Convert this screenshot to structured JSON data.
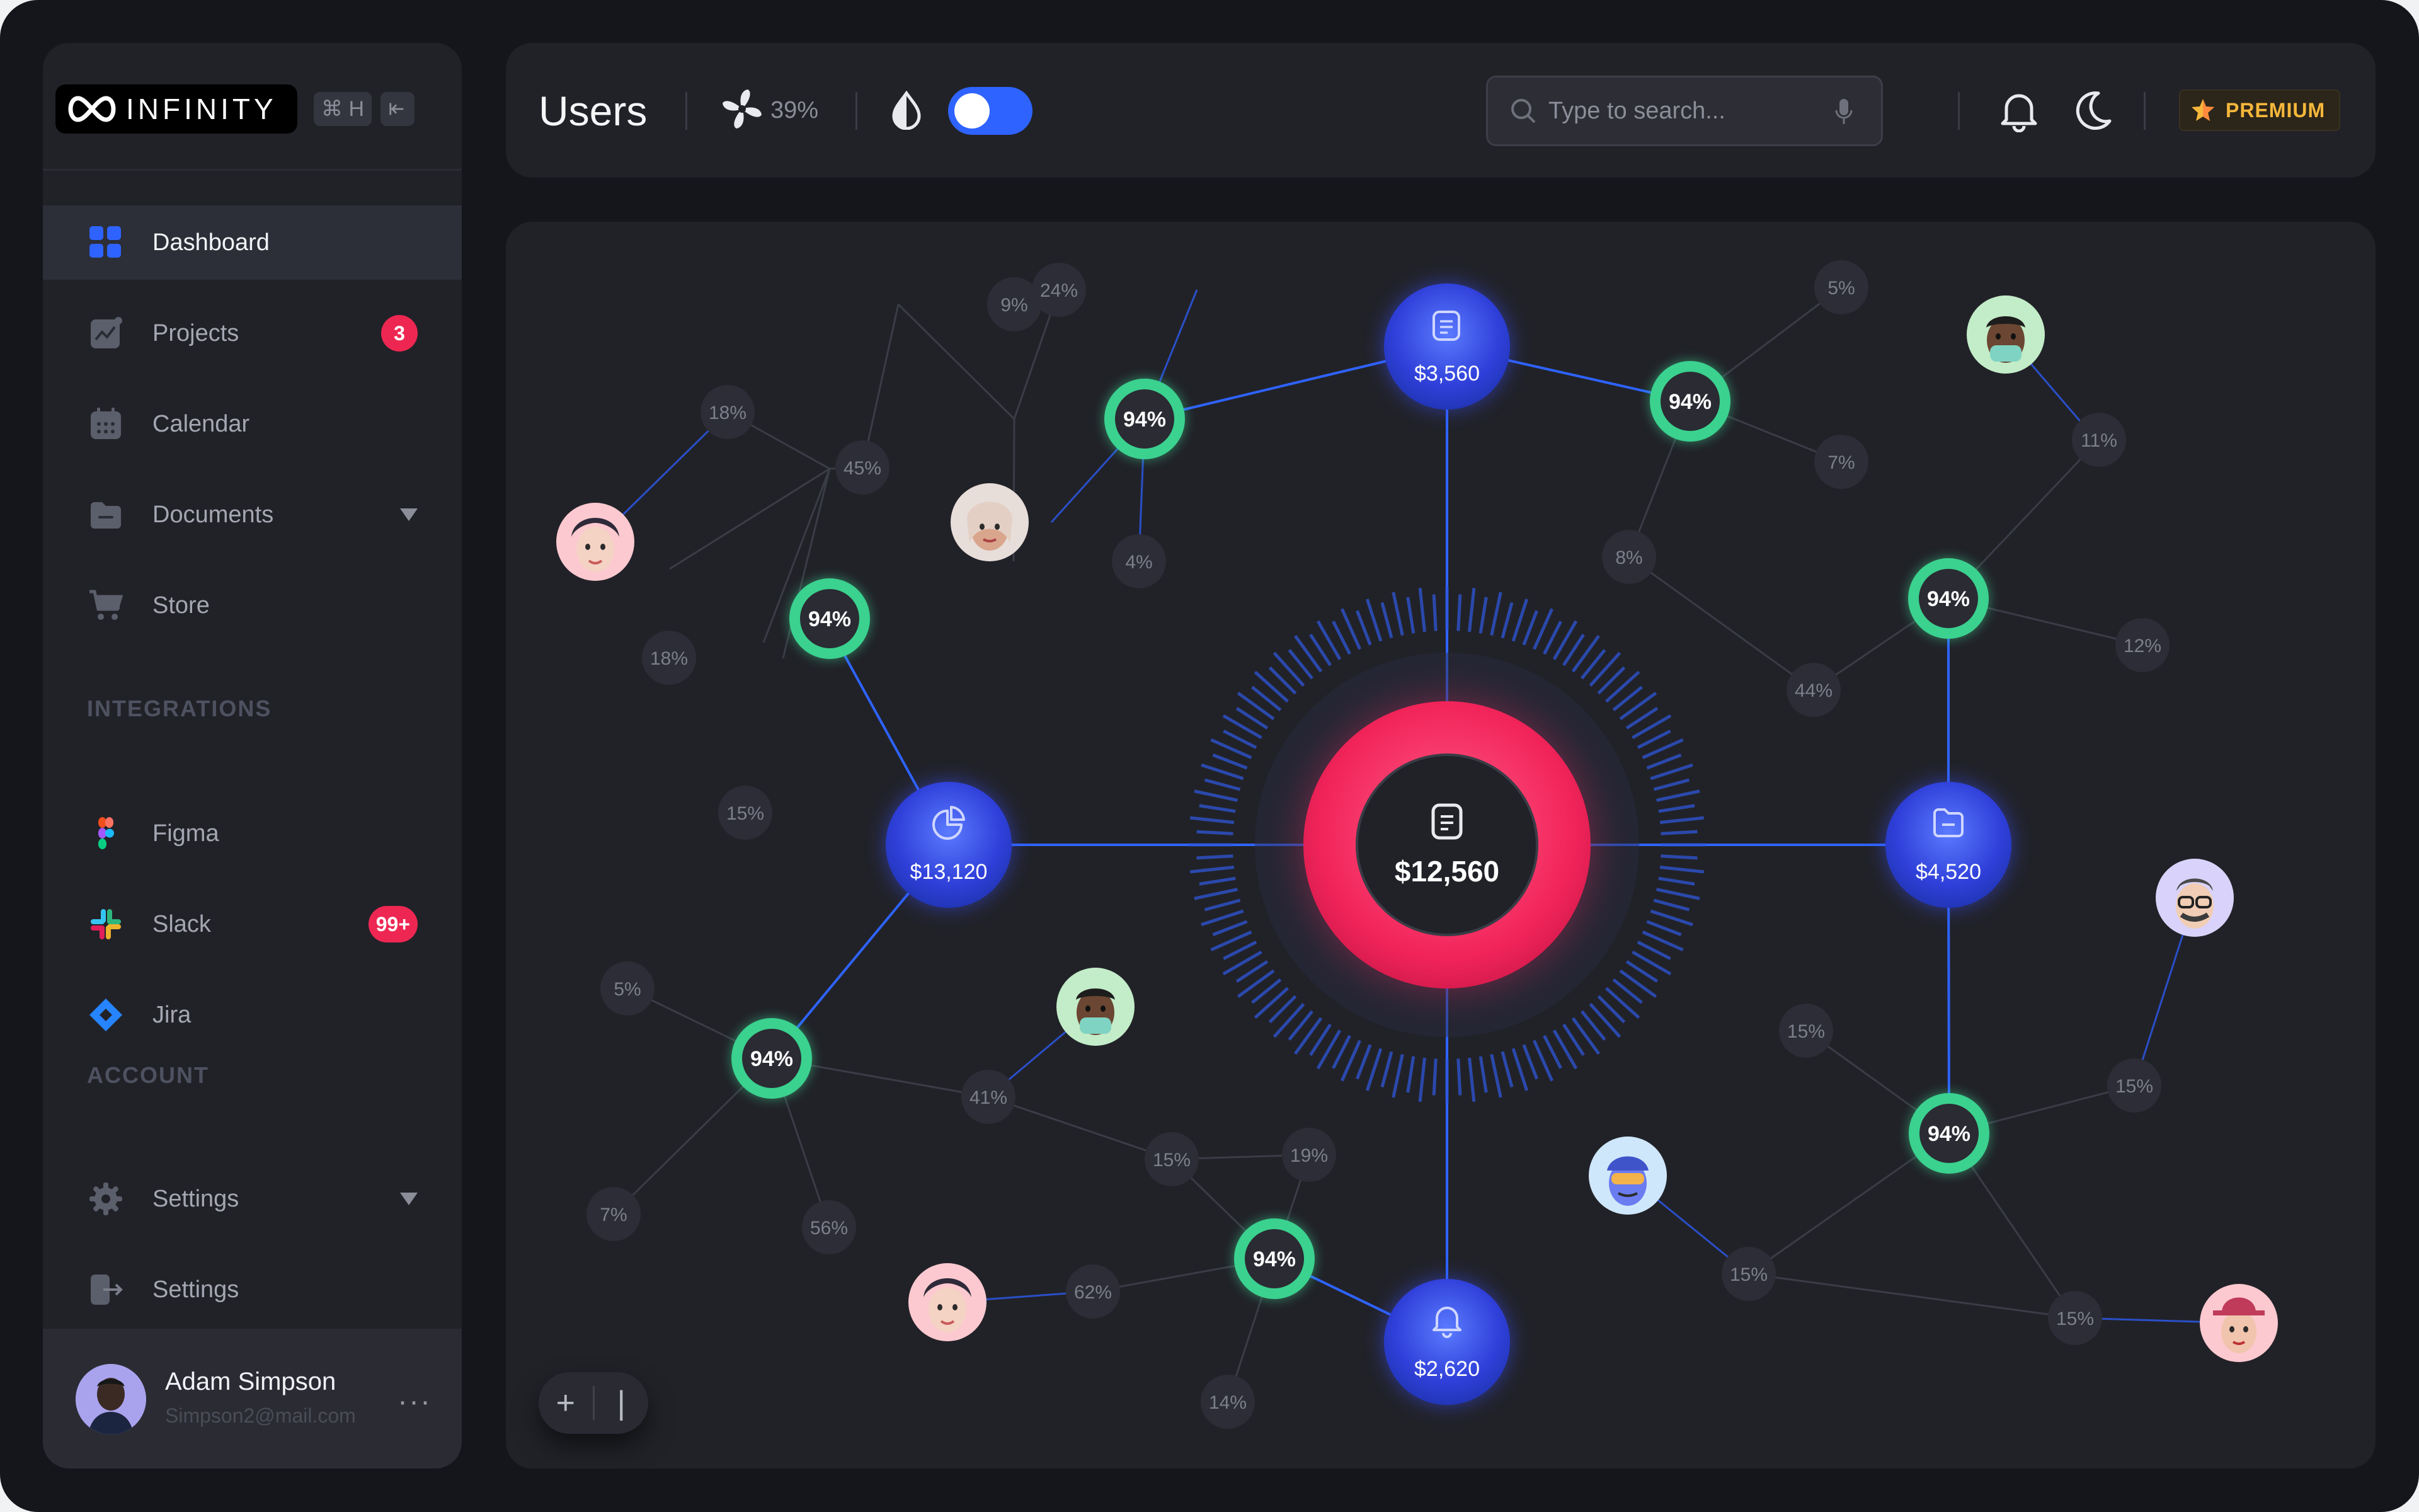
{
  "app": {
    "logo_text": "INFINITY",
    "shortcut_key": "⌘ H",
    "collapse_icon": "arrow-left-icon"
  },
  "sidebar": {
    "items": [
      {
        "label": "Dashboard",
        "icon": "grid-icon",
        "active": true
      },
      {
        "label": "Projects",
        "icon": "chart-icon",
        "badge": "3"
      },
      {
        "label": "Calendar",
        "icon": "calendar-icon"
      },
      {
        "label": "Documents",
        "icon": "folder-icon",
        "has_dropdown": true
      },
      {
        "label": "Store",
        "icon": "cart-icon"
      }
    ],
    "integrations_title": "INTEGRATIONS",
    "integrations": [
      {
        "label": "Figma",
        "icon": "figma-icon"
      },
      {
        "label": "Slack",
        "icon": "slack-icon",
        "badge": "99+"
      },
      {
        "label": "Jira",
        "icon": "jira-icon"
      }
    ],
    "account_title": "ACCOUNT",
    "account": [
      {
        "label": "Settings",
        "icon": "gear-icon",
        "has_dropdown": true
      },
      {
        "label": "Settings",
        "icon": "logout-icon"
      }
    ],
    "user": {
      "name": "Adam Simpson",
      "email": "Simpson2@mail.com"
    }
  },
  "header": {
    "title": "Users",
    "fan_percent": "39%",
    "toggle_on": true,
    "search_placeholder": "Type to search...",
    "premium_label": "PREMIUM"
  },
  "graph": {
    "center_value": "$12,560",
    "hubs": [
      {
        "id": "hub-top",
        "value": "$3,560",
        "icon": "document-icon"
      },
      {
        "id": "hub-left",
        "value": "$13,120",
        "icon": "pie-icon"
      },
      {
        "id": "hub-right",
        "value": "$4,520",
        "icon": "folder-icon"
      },
      {
        "id": "hub-bottom",
        "value": "$2,620",
        "icon": "bell-icon"
      }
    ],
    "green_nodes": [
      "94%",
      "94%",
      "94%",
      "94%",
      "94%",
      "94%",
      "94%"
    ],
    "percent_labels": [
      "9%",
      "24%",
      "18%",
      "45%",
      "4%",
      "18%",
      "15%",
      "5%",
      "7%",
      "8%",
      "11%",
      "12%",
      "44%",
      "5%",
      "41%",
      "7%",
      "56%",
      "15%",
      "19%",
      "62%",
      "14%",
      "15%",
      "15%",
      "15%",
      "15%"
    ]
  },
  "colors": {
    "accent_blue": "#2e63ff",
    "accent_pink": "#ff3d6e",
    "accent_green": "#3ddc97",
    "badge_red": "#ee2752",
    "premium_gold": "#f5b73b"
  }
}
